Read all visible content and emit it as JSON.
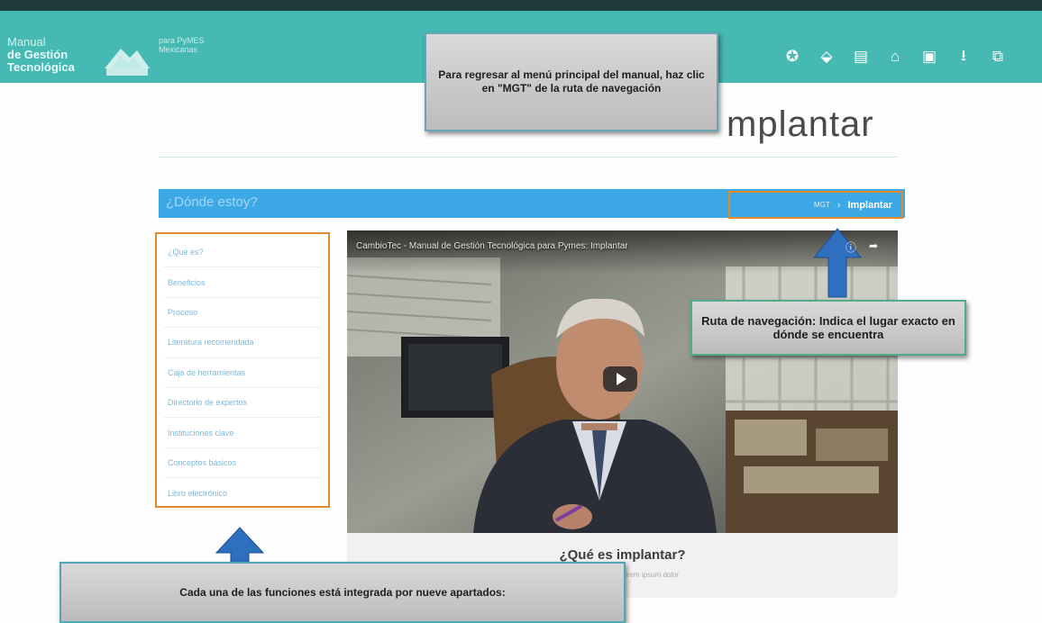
{
  "header": {
    "logo_line1": "Manual",
    "logo_line2": "de Gestión",
    "logo_line3": "Tecnológica",
    "logo_sub_line1": "para PyMES",
    "logo_sub_line2": "Mexicanas",
    "icons": [
      "compass-icon",
      "hand-coin-icon",
      "id-card-icon",
      "institution-icon",
      "chat-icon",
      "download-icon",
      "external-link-icon"
    ],
    "icon_glyphs": [
      "✪",
      "⬙",
      "▤",
      "⌂",
      "▣",
      "⭳",
      "⧉"
    ]
  },
  "callouts": {
    "top": "Para regresar al menú principal del manual, haz clic en \"MGT\" de la ruta de navegación",
    "right": "Ruta de navegación: Indica el lugar exacto en dónde se encuentra",
    "bottom": "Cada una de las funciones está integrada por nueve apartados:"
  },
  "page": {
    "title": "mplantar"
  },
  "where": {
    "label": "¿Dónde estoy?",
    "breadcrumb_home": "MGT",
    "breadcrumb_sep": "›",
    "breadcrumb_current": "Implantar"
  },
  "menu": {
    "items": [
      "¿Qué es?",
      "Beneficios",
      "Proceso",
      "Literatura recomendada",
      "Caja de herramientas",
      "Directorio de expertos",
      "Instituciones clave",
      "Conceptos básicos",
      "Libro electrónico"
    ]
  },
  "video": {
    "title": "CambioTec - Manual de Gestión Tecnológica para Pymes: Implantar",
    "action_info": "ⓘ",
    "action_share": "➦",
    "caption_title": "¿Qué es implantar?",
    "caption_sub": "Lorem ipsum dolor"
  },
  "colors": {
    "header": "#46b9b2",
    "where_bar": "#3da8e6",
    "highlight_border": "#e08a2c",
    "arrow": "#2e6fbf"
  }
}
